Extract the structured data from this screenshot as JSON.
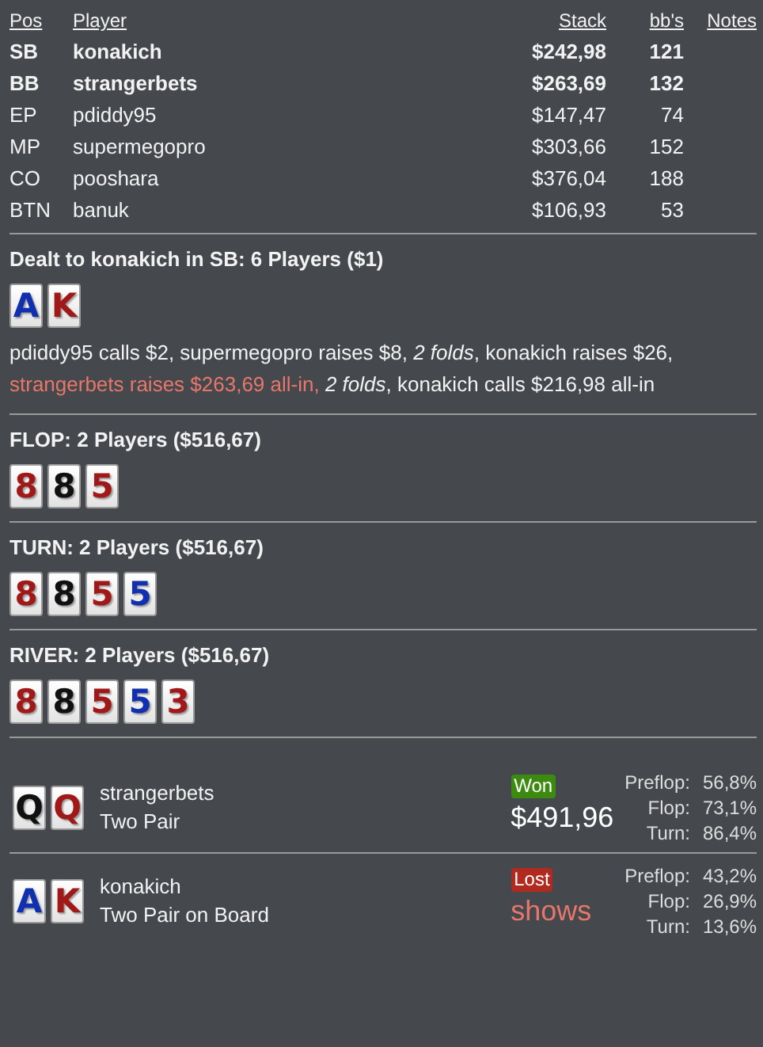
{
  "players": {
    "columns": [
      "Pos",
      "Player",
      "Stack",
      "bb's",
      "Notes"
    ],
    "rows": [
      {
        "pos": "SB",
        "name": "konakich",
        "stack": "$242,98",
        "bbs": "121",
        "hero": true
      },
      {
        "pos": "BB",
        "name": "strangerbets",
        "stack": "$263,69",
        "bbs": "132",
        "hero": true
      },
      {
        "pos": "EP",
        "name": "pdiddy95",
        "stack": "$147,47",
        "bbs": "74",
        "hero": false
      },
      {
        "pos": "MP",
        "name": "supermegopro",
        "stack": "$303,66",
        "bbs": "152",
        "hero": false
      },
      {
        "pos": "CO",
        "name": "pooshara",
        "stack": "$376,04",
        "bbs": "188",
        "hero": false
      },
      {
        "pos": "BTN",
        "name": "banuk",
        "stack": "$106,93",
        "bbs": "53",
        "hero": false
      }
    ]
  },
  "streets": [
    {
      "heading": "Dealt to konakich in SB: 6 Players ($1)",
      "cards": [
        {
          "rank": "A",
          "color": "#1030b0"
        },
        {
          "rank": "K",
          "color": "#a01818"
        }
      ],
      "actions": [
        {
          "text": "pdiddy95 calls $2, supermegopro raises $8, ",
          "kind": "plain"
        },
        {
          "text": "2 folds",
          "kind": "italic"
        },
        {
          "text": ", konakich raises $26, ",
          "kind": "plain"
        },
        {
          "text": "strangerbets raises $263,69 all-in, ",
          "kind": "allin"
        },
        {
          "text": "2 folds",
          "kind": "italic"
        },
        {
          "text": ", konakich calls $216,98 all-in",
          "kind": "plain"
        }
      ]
    },
    {
      "heading": "FLOP: 2 Players ($516,67)",
      "cards": [
        {
          "rank": "8",
          "color": "#a01818"
        },
        {
          "rank": "8",
          "color": "#101010"
        },
        {
          "rank": "5",
          "color": "#a01818"
        }
      ]
    },
    {
      "heading": "TURN: 2 Players ($516,67)",
      "cards": [
        {
          "rank": "8",
          "color": "#a01818"
        },
        {
          "rank": "8",
          "color": "#101010"
        },
        {
          "rank": "5",
          "color": "#a01818"
        },
        {
          "rank": "5",
          "color": "#1030b0"
        }
      ]
    },
    {
      "heading": "RIVER: 2 Players ($516,67)",
      "cards": [
        {
          "rank": "8",
          "color": "#a01818"
        },
        {
          "rank": "8",
          "color": "#101010"
        },
        {
          "rank": "5",
          "color": "#a01818"
        },
        {
          "rank": "5",
          "color": "#1030b0"
        },
        {
          "rank": "3",
          "color": "#a01818"
        }
      ]
    }
  ],
  "results": [
    {
      "cards": [
        {
          "rank": "Q",
          "color": "#101010"
        },
        {
          "rank": "Q",
          "color": "#a01818"
        }
      ],
      "name": "strangerbets",
      "hand": "Two Pair",
      "outcome": "Won",
      "kind": "won",
      "amount": "$491,96",
      "equity": [
        {
          "label": "Preflop:",
          "value": "56,8%"
        },
        {
          "label": "Flop:",
          "value": "73,1%"
        },
        {
          "label": "Turn:",
          "value": "86,4%"
        }
      ]
    },
    {
      "cards": [
        {
          "rank": "A",
          "color": "#1030b0"
        },
        {
          "rank": "K",
          "color": "#a01818"
        }
      ],
      "name": "konakich",
      "hand": "Two Pair on Board",
      "outcome": "Lost",
      "kind": "lost",
      "amount": "shows",
      "equity": [
        {
          "label": "Preflop:",
          "value": "43,2%"
        },
        {
          "label": "Flop:",
          "value": "26,9%"
        },
        {
          "label": "Turn:",
          "value": "13,6%"
        }
      ]
    }
  ]
}
